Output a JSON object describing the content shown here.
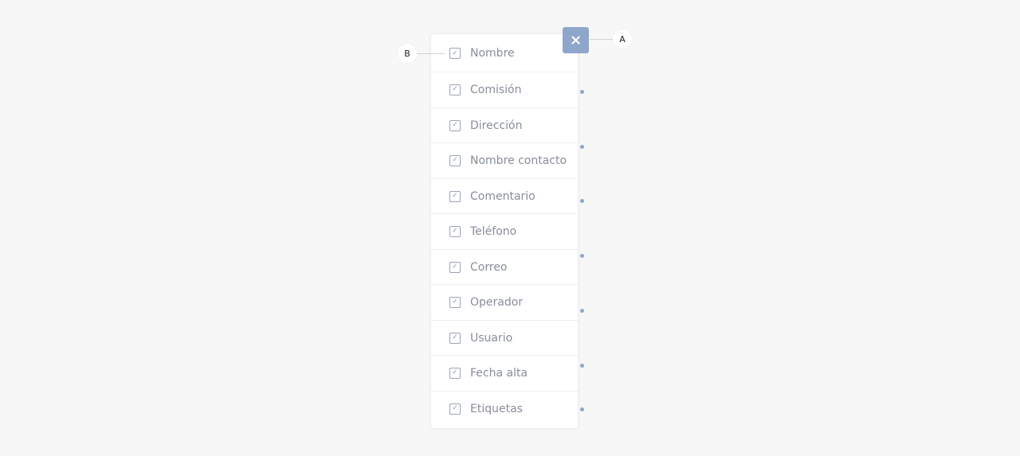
{
  "columns_panel": {
    "items": [
      {
        "label": "Nombre",
        "checked": true
      },
      {
        "label": "Comisión",
        "checked": true
      },
      {
        "label": "Dirección",
        "checked": true
      },
      {
        "label": "Nombre contacto",
        "checked": true
      },
      {
        "label": "Comentario",
        "checked": true
      },
      {
        "label": "Teléfono",
        "checked": true
      },
      {
        "label": "Correo",
        "checked": true
      },
      {
        "label": "Operador",
        "checked": true
      },
      {
        "label": "Usuario",
        "checked": true
      },
      {
        "label": "Fecha alta",
        "checked": true
      },
      {
        "label": "Etiquetas",
        "checked": true
      }
    ],
    "check_glyph": "✓"
  },
  "close_button": {
    "icon": "close-icon"
  },
  "annotations": {
    "a_label": "A",
    "b_label": "B"
  },
  "colors": {
    "background": "#f7f7f7",
    "accent": "#8fa6cb",
    "label_text": "#878d99"
  }
}
